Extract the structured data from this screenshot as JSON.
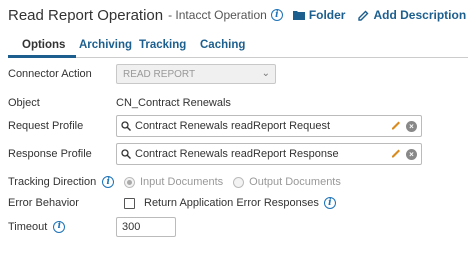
{
  "header": {
    "title": "Read Report Operation",
    "subtitle": "- Intacct Operation",
    "folder_label": "Folder",
    "add_description_label": "Add Description"
  },
  "tabs": [
    {
      "label": "Options",
      "active": true
    },
    {
      "label": "Archiving",
      "active": false
    },
    {
      "label": "Tracking",
      "active": false
    },
    {
      "label": "Caching",
      "active": false
    }
  ],
  "form": {
    "connector_action": {
      "label": "Connector Action",
      "value": "READ REPORT"
    },
    "object": {
      "label": "Object",
      "value": "CN_Contract Renewals"
    },
    "request_profile": {
      "label": "Request Profile",
      "value": "Contract Renewals readReport Request"
    },
    "response_profile": {
      "label": "Response Profile",
      "value": "Contract Renewals readReport Response"
    },
    "tracking_direction": {
      "label": "Tracking Direction",
      "options": [
        "Input Documents",
        "Output Documents"
      ],
      "selected": "Input Documents"
    },
    "error_behavior": {
      "label": "Error Behavior",
      "checkbox_label": "Return Application Error Responses",
      "checked": false
    },
    "timeout": {
      "label": "Timeout",
      "value": "300"
    }
  },
  "colors": {
    "accent": "#1c5f8f",
    "info": "#1e73b8"
  },
  "icons": [
    "info-icon",
    "folder-icon",
    "pencil-icon",
    "search-icon",
    "clear-icon",
    "chevron-down-icon"
  ]
}
